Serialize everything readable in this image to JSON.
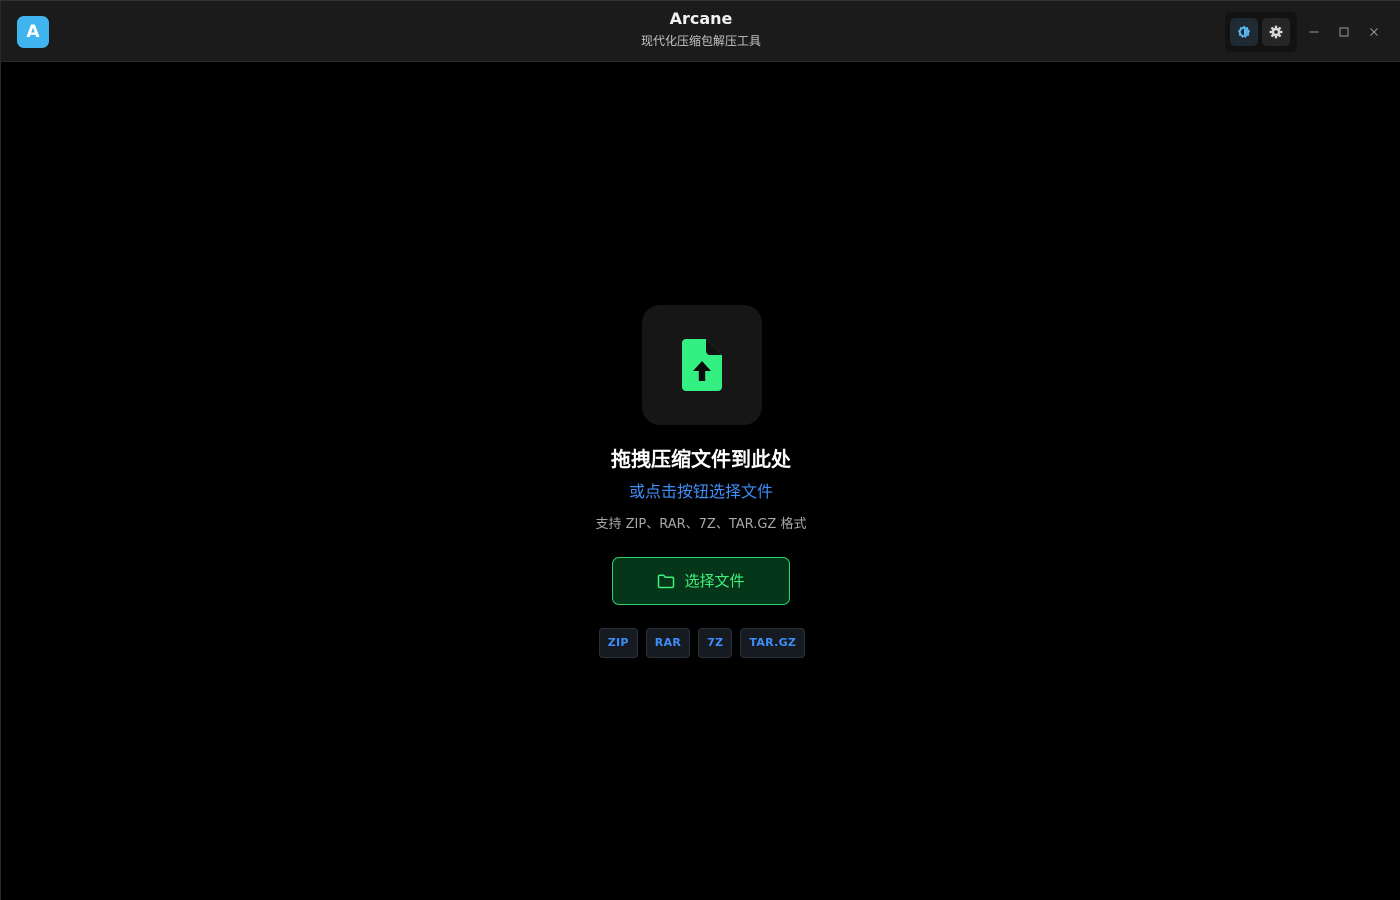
{
  "app": {
    "logo_letter": "A",
    "title": "Arcane",
    "subtitle": "现代化压缩包解压工具"
  },
  "toolbar": {
    "theme_icon": "theme-contrast-icon",
    "settings_icon": "gear-icon"
  },
  "window_controls": {
    "minimize_icon": "minimize-icon",
    "maximize_icon": "maximize-icon",
    "close_icon": "close-icon"
  },
  "drop_zone": {
    "icon": "file-upload-icon",
    "title": "拖拽压缩文件到此处",
    "link_text": "或点击按钮选择文件",
    "hint": "支持 ZIP、RAR、7Z、TAR.GZ 格式",
    "select_button": {
      "icon": "folder-icon",
      "label": "选择文件"
    },
    "formats": [
      "ZIP",
      "RAR",
      "7Z",
      "TAR.GZ"
    ]
  },
  "colors": {
    "accent_green": "#3ff07c",
    "accent_blue": "#3d8ef8",
    "logo_blue": "#3fb4ee",
    "background": "#000000",
    "titlebar": "#1b1b1b"
  }
}
